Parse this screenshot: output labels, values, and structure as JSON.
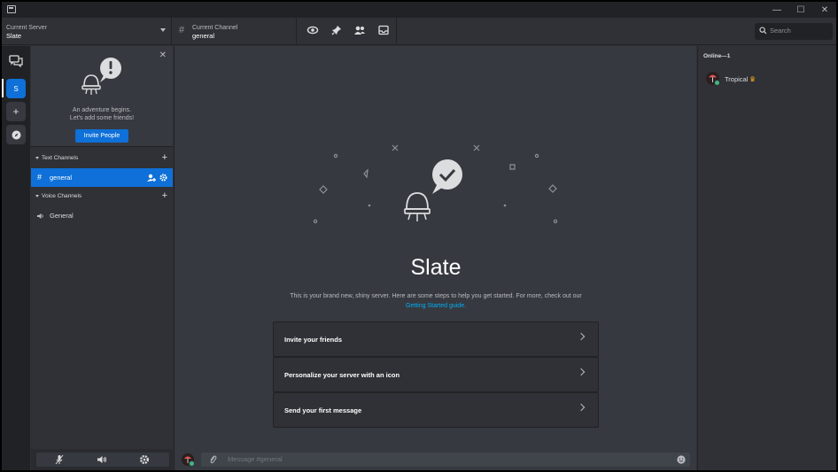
{
  "window": {
    "minimize": "—",
    "maximize": "☐",
    "close": "✕"
  },
  "topbar": {
    "server_label": "Current Server",
    "server_name": "Slate",
    "channel_label": "Current Channel",
    "channel_name": "general",
    "search_placeholder": "Search"
  },
  "rail": {
    "server_initial": "S",
    "add_symbol": "+"
  },
  "invite": {
    "line1": "An adventure begins.",
    "line2": "Let's add some friends!",
    "button": "Invite People"
  },
  "channels": {
    "text_category": "Text Channels",
    "text_items": [
      {
        "name": "general"
      }
    ],
    "voice_category": "Voice Channels",
    "voice_items": [
      {
        "name": "General"
      }
    ]
  },
  "main": {
    "title": "Slate",
    "description": "This is your brand new, shiny server. Here are some steps to help you get started. For more, check out our",
    "guide_link": "Getting Started guide.",
    "cards": [
      {
        "label": "Invite your friends"
      },
      {
        "label": "Personalize your server with an icon"
      },
      {
        "label": "Send your first message"
      }
    ]
  },
  "message": {
    "placeholder": "Message #general"
  },
  "members": {
    "header": "Online—1",
    "list": [
      {
        "name": "Tropical",
        "status_color": "#43b581"
      }
    ]
  },
  "colors": {
    "accent": "#0e70d8",
    "online": "#43b581",
    "crown": "#faa61a",
    "link": "#00aff4"
  }
}
